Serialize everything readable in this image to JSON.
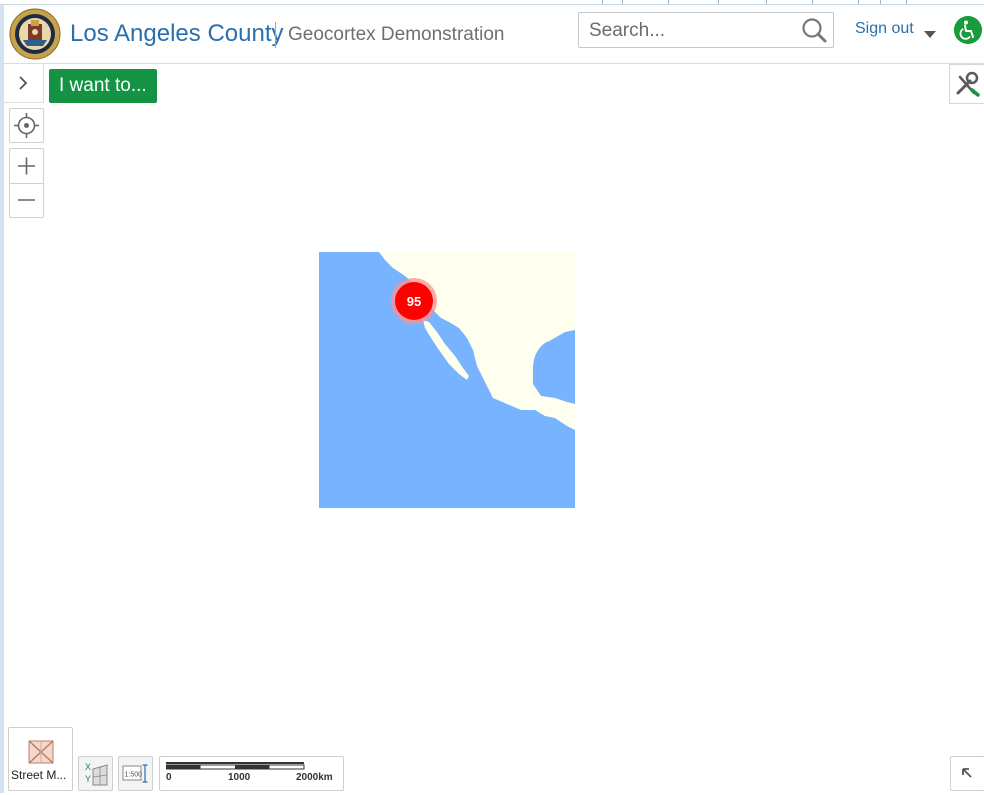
{
  "header": {
    "title": "Los Angeles County",
    "subtitle": "Geocortex Demonstration",
    "seal": "los-angeles-county-seal",
    "search": {
      "placeholder": "Search..."
    },
    "sign_out_label": "Sign out",
    "accessibility_icon": "accessibility-icon"
  },
  "toolbar": {
    "i_want_to_label": "I want to...",
    "panel_toggle_icon": "chevron-right-icon",
    "tools_icon": "tools-icon"
  },
  "map": {
    "cluster": {
      "count": "95",
      "color": "#ff0000"
    },
    "water_color": "#78b3ff",
    "land_color": "#fffff0"
  },
  "bottom": {
    "basemap_label": "Street M...",
    "scale_labels": [
      "0",
      "1000",
      "2000km"
    ],
    "scale_ratio_icon": "1:500"
  },
  "colors": {
    "accent_green": "#139343",
    "link_blue": "#2a6fae"
  }
}
